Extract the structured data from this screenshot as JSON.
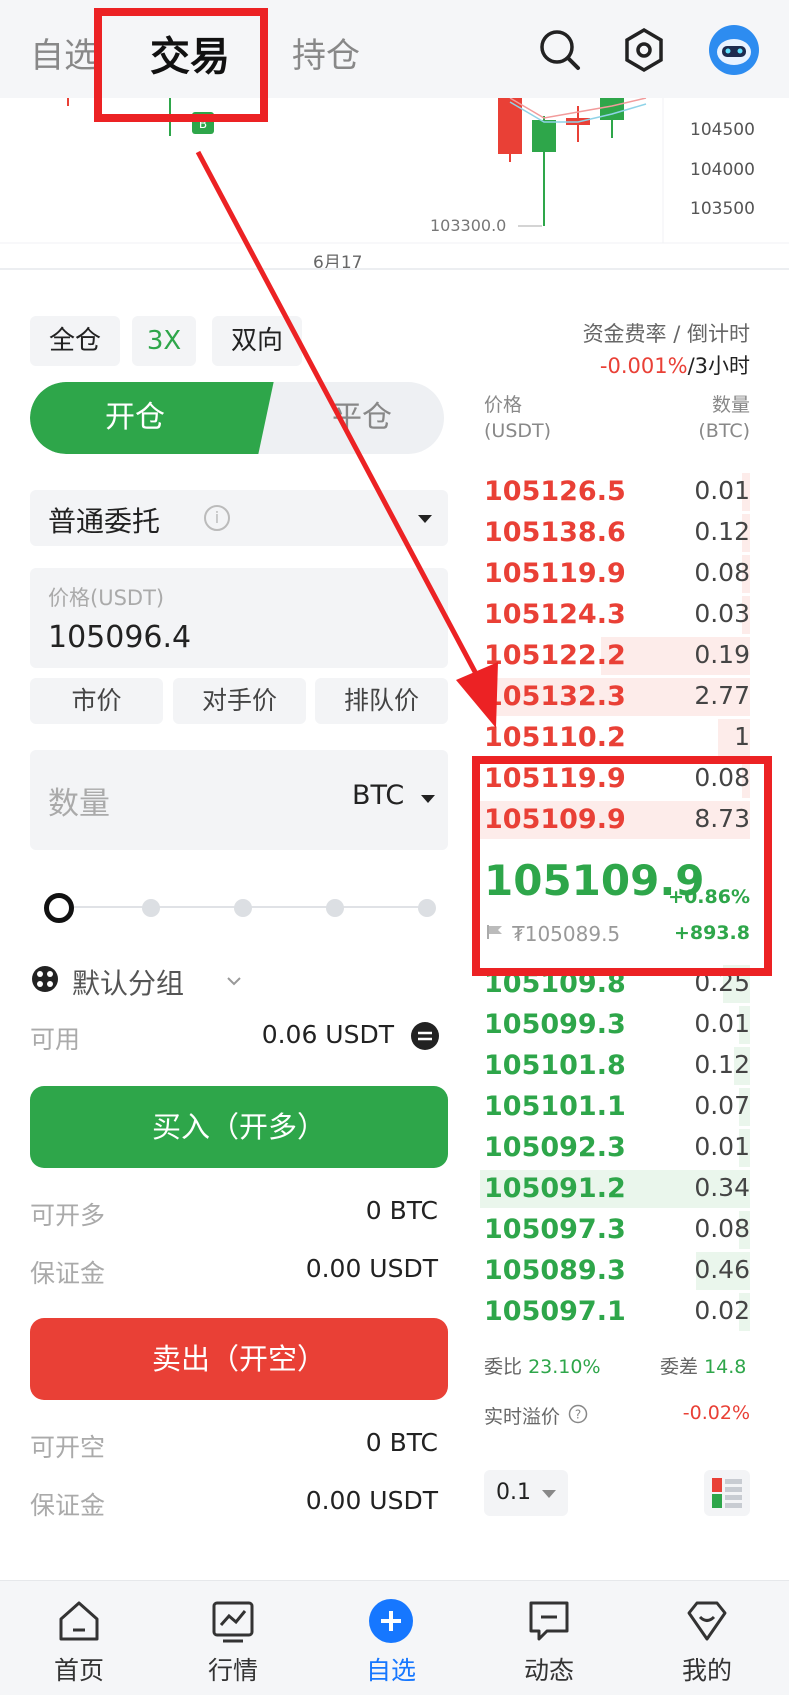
{
  "header": {
    "tabs": [
      {
        "label": "自选",
        "active": false
      },
      {
        "label": "交易",
        "active": true
      },
      {
        "label": "持仓",
        "active": false
      }
    ],
    "icons": [
      "search-icon",
      "settings-hex-icon",
      "robot-avatar-icon"
    ]
  },
  "chart": {
    "price_axis": [
      "104500",
      "104000",
      "103500"
    ],
    "low_marker": "103300.0",
    "date_label": "6月17"
  },
  "trade": {
    "margin_mode": "全仓",
    "leverage": "3X",
    "position_mode": "双向",
    "open_tab": "开仓",
    "close_tab": "平仓",
    "order_type": "普通委托",
    "price_placeholder": "价格(USDT)",
    "price_value": "105096.4",
    "quick_prices": [
      "市价",
      "对手价",
      "排队价"
    ],
    "qty_placeholder": "数量",
    "qty_unit": "BTC",
    "slider_level": 0,
    "group_label": "默认分组",
    "available_label": "可用",
    "available_value": "0.06 USDT",
    "buy_button": "买入（开多）",
    "can_open_long_label": "可开多",
    "can_open_long_value": "0  BTC",
    "margin_label": "保证金",
    "margin_long_value": "0.00  USDT",
    "sell_button": "卖出（开空）",
    "can_open_short_label": "可开空",
    "can_open_short_value": "0  BTC",
    "margin_short_value": "0.00  USDT"
  },
  "orderbook": {
    "funding_label": "资金费率 / 倒计时",
    "funding_rate": "-0.001%",
    "funding_countdown": "/3小时",
    "price_header": [
      "价格",
      "(USDT)"
    ],
    "qty_header": [
      "数量",
      "(BTC)"
    ],
    "asks": [
      {
        "price": "105126.5",
        "qty": "0.01",
        "depth": 0.03
      },
      {
        "price": "105138.6",
        "qty": "0.12",
        "depth": 0.03
      },
      {
        "price": "105119.9",
        "qty": "0.08",
        "depth": 0.03
      },
      {
        "price": "105124.3",
        "qty": "0.03",
        "depth": 0.03
      },
      {
        "price": "105122.2",
        "qty": "0.19",
        "depth": 0.55
      },
      {
        "price": "105132.3",
        "qty": "2.77",
        "depth": 0.95
      },
      {
        "price": "105110.2",
        "qty": "1",
        "depth": 0.12
      },
      {
        "price": "105119.9",
        "qty": "0.08",
        "depth": 0.03
      },
      {
        "price": "105109.9",
        "qty": "8.73",
        "depth": 1.0
      }
    ],
    "last_price": "105109.9",
    "change_pct": "+0.86%",
    "index_price": "₮105089.5",
    "change_abs": "+893.8",
    "bids": [
      {
        "price": "105109.8",
        "qty": "0.25",
        "depth": 0.1
      },
      {
        "price": "105099.3",
        "qty": "0.01",
        "depth": 0.04
      },
      {
        "price": "105101.8",
        "qty": "0.12",
        "depth": 0.06
      },
      {
        "price": "105101.1",
        "qty": "0.07",
        "depth": 0.04
      },
      {
        "price": "105092.3",
        "qty": "0.01",
        "depth": 0.04
      },
      {
        "price": "105091.2",
        "qty": "0.34",
        "depth": 1.0
      },
      {
        "price": "105097.3",
        "qty": "0.08",
        "depth": 0.04
      },
      {
        "price": "105089.3",
        "qty": "0.46",
        "depth": 0.2
      },
      {
        "price": "105097.1",
        "qty": "0.02",
        "depth": 0.04
      }
    ],
    "bid_ratio_label": "委比",
    "bid_ratio_value": "23.10%",
    "bid_diff_label": "委差",
    "bid_diff_value": "14.8",
    "premium_label": "实时溢价",
    "premium_value": "-0.02%",
    "depth_step": "0.1"
  },
  "bottom_nav": [
    {
      "label": "首页",
      "icon": "home-icon",
      "active": false
    },
    {
      "label": "行情",
      "icon": "market-chart-icon",
      "active": false
    },
    {
      "label": "自选",
      "icon": "plus-circle-icon",
      "active": true
    },
    {
      "label": "动态",
      "icon": "message-icon",
      "active": false
    },
    {
      "label": "我的",
      "icon": "profile-gem-icon",
      "active": false
    }
  ],
  "colors": {
    "green": "#2ea64a",
    "red": "#e94036",
    "annotation": "#ec2224",
    "nav_active": "#1677ff"
  }
}
